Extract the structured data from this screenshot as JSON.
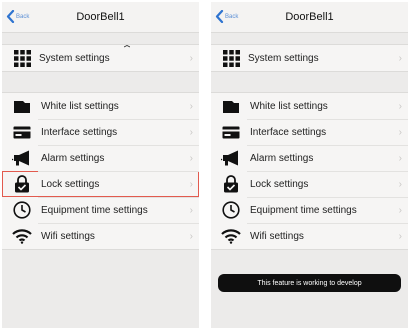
{
  "screens": [
    {
      "nav": {
        "back_label": "Back",
        "title": "DoorBell1"
      },
      "system_settings": {
        "label": "System settings",
        "icon": "grid-icon"
      },
      "items": [
        {
          "label": "White list settings",
          "icon": "folder-icon"
        },
        {
          "label": "Interface settings",
          "icon": "card-icon"
        },
        {
          "label": "Alarm settings",
          "icon": "megaphone-icon"
        },
        {
          "label": "Lock settings",
          "icon": "lock-icon",
          "highlighted": true
        },
        {
          "label": "Equipment time settings",
          "icon": "clock-icon"
        },
        {
          "label": "Wifi settings",
          "icon": "wifi-icon"
        }
      ]
    },
    {
      "nav": {
        "back_label": "Back",
        "title": "DoorBell1"
      },
      "system_settings": {
        "label": "System settings",
        "icon": "grid-icon"
      },
      "items": [
        {
          "label": "White list settings",
          "icon": "folder-icon"
        },
        {
          "label": "Interface settings",
          "icon": "card-icon"
        },
        {
          "label": "Alarm settings",
          "icon": "megaphone-icon"
        },
        {
          "label": "Lock settings",
          "icon": "lock-icon"
        },
        {
          "label": "Equipment time settings",
          "icon": "clock-icon"
        },
        {
          "label": "Wifi settings",
          "icon": "wifi-icon"
        }
      ],
      "toast": "This feature is working to develop"
    }
  ],
  "colors": {
    "accent": "#5b8fd6",
    "highlight": "#e25a4e",
    "toast_bg": "#0f0f0f"
  }
}
